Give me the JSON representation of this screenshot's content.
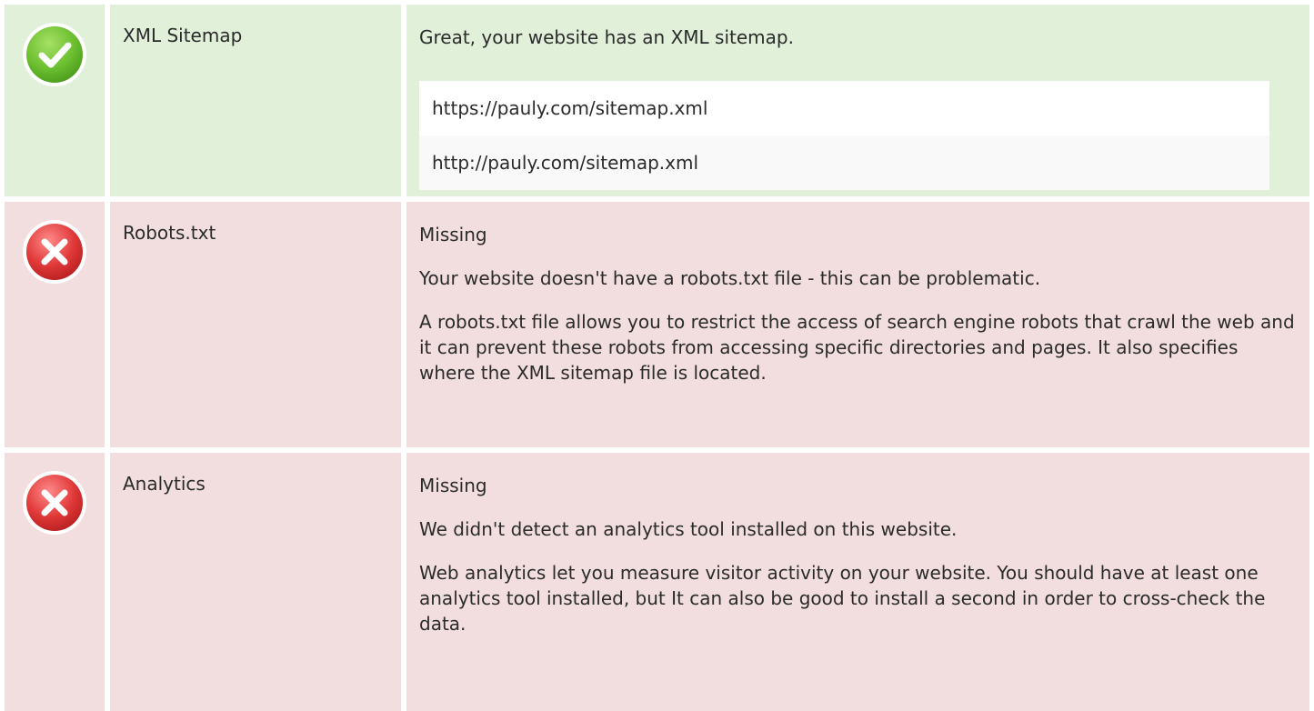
{
  "checks": [
    {
      "status": "success",
      "icon": "check-icon",
      "label": "XML Sitemap",
      "summary": "Great, your website has an XML sitemap.",
      "urls": [
        "https://pauly.com/sitemap.xml",
        "http://pauly.com/sitemap.xml"
      ]
    },
    {
      "status": "error",
      "icon": "cross-icon",
      "label": "Robots.txt",
      "summary": "Missing",
      "details": [
        "Your website doesn't have a robots.txt file - this can be problematic.",
        "A robots.txt file allows you to restrict the access of search engine robots that crawl the web and it can prevent these robots from accessing specific directories and pages. It also specifies where the XML sitemap file is located."
      ]
    },
    {
      "status": "error",
      "icon": "cross-icon",
      "label": "Analytics",
      "summary": "Missing",
      "details": [
        "We didn't detect an analytics tool installed on this website.",
        "Web analytics let you measure visitor activity on your website. You should have at least one analytics tool installed, but It can also be good to install a second in order to cross-check the data."
      ]
    }
  ],
  "colors": {
    "success_bg": "#e0f0d9",
    "error_bg": "#f2dede",
    "success_icon": "#6cbf2f",
    "error_icon": "#e03838"
  }
}
